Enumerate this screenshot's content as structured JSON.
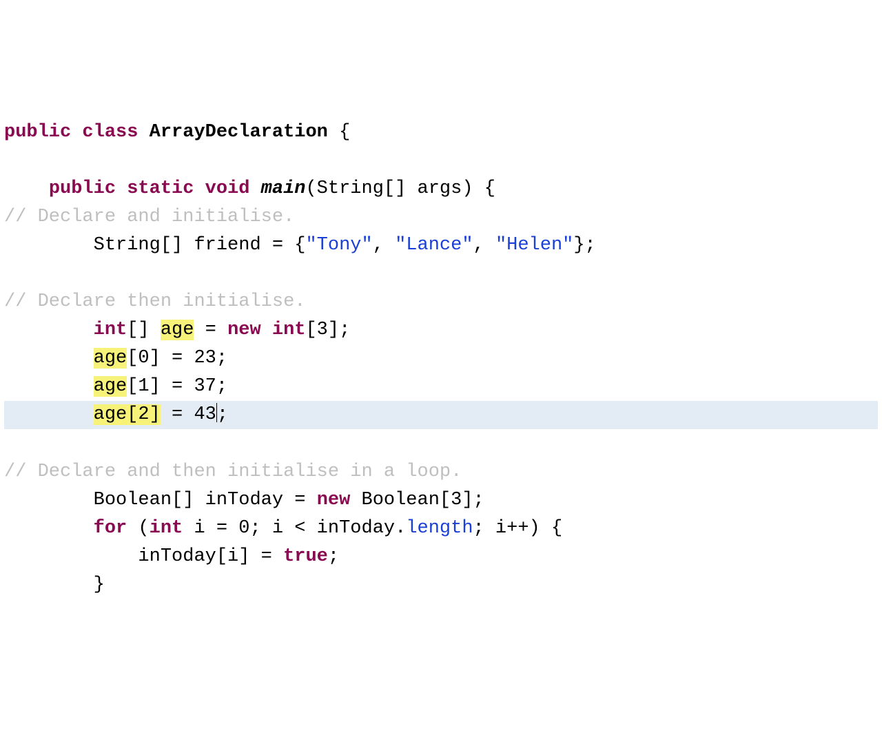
{
  "code": {
    "l1": {
      "kw1": "public",
      "kw2": "class",
      "cls": "ArrayDeclaration",
      "brace": "{"
    },
    "l2": {
      "kw1": "public",
      "kw2": "static",
      "kw3": "void",
      "mth": "main",
      "sig": "(String[] args) {"
    },
    "c1": "// Declare and initialise.",
    "l3": {
      "pre": "String[] friend = {",
      "s1": "\"Tony\"",
      "s2": "\"Lance\"",
      "s3": "\"Helen\"",
      "post": "};"
    },
    "c2": "// Declare then initialise.",
    "l4": {
      "kw1": "int",
      "br": "[]",
      "var": "age",
      "eq": " = ",
      "kw2": "new",
      "kw3": "int",
      "tail": "[3];"
    },
    "l5": {
      "var": "age",
      "idx": "[0] = 23;"
    },
    "l6": {
      "var": "age",
      "idx": "[1] = 37;"
    },
    "l7": {
      "var": "age",
      "idx1": "[",
      "n": "2",
      "idx2": "]",
      "rhs": " = 43",
      "semi": ";"
    },
    "c3": "// Declare and then initialise in a loop.",
    "l8": {
      "pre": "Boolean[] inToday = ",
      "kw": "new",
      "post": " Boolean[3];"
    },
    "l9": {
      "kw": "for",
      "p1": " (",
      "kw2": "int",
      "mid": " i = 0; i < inToday.",
      "len": "length",
      "tail": "; i++) {"
    },
    "l10": {
      "pre": "inToday[i] = ",
      "kw": "true",
      "post": ";"
    },
    "l11": "}"
  }
}
